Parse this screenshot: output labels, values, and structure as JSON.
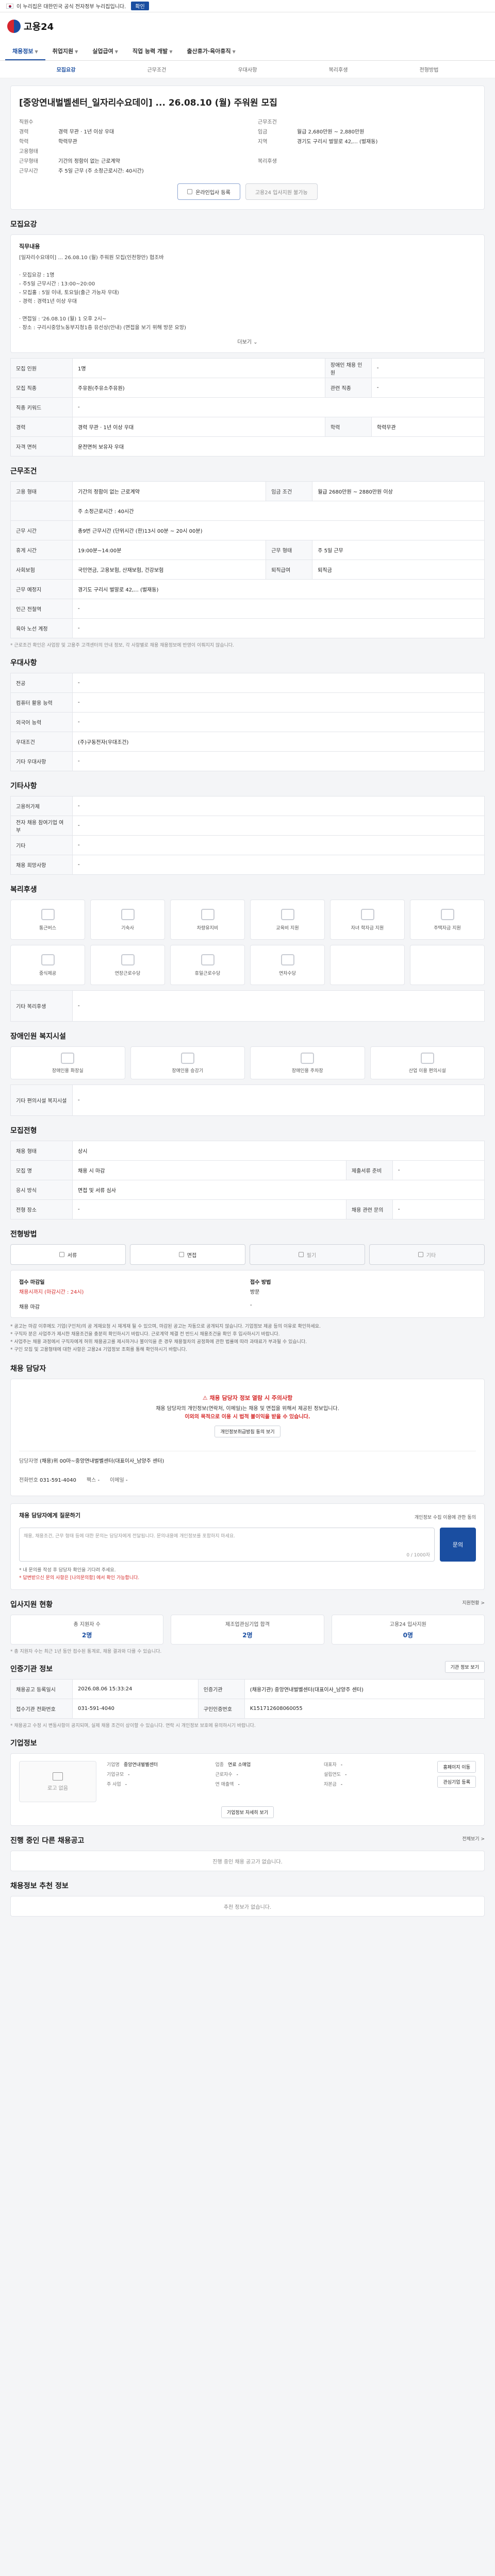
{
  "topbar": {
    "gov_notice": "이 누리집은 대한민국 공식 전자정부 누리집입니다.",
    "notice_btn": "확인"
  },
  "header": {
    "brand": "고용24"
  },
  "gnb": [
    {
      "label": "채용정보",
      "active": true
    },
    {
      "label": "취업지원",
      "active": false
    },
    {
      "label": "실업급여",
      "active": false
    },
    {
      "label": "직업 능력 개발",
      "active": false
    },
    {
      "label": "출산휴가·육아휴직",
      "active": false
    }
  ],
  "subnav": [
    {
      "label": "모집요강",
      "on": true
    },
    {
      "label": "근무조건",
      "on": false
    },
    {
      "label": "우대사항",
      "on": false
    },
    {
      "label": "복리후생",
      "on": false
    },
    {
      "label": "전형방법",
      "on": false
    }
  ],
  "job": {
    "title": "[중앙연내벌벨센터_일자리수요데이] ... 26.08.10 (월) 주워원 모집",
    "company_label": "직원을 찾는 기업",
    "left": [
      {
        "k": "직원수",
        "v": ""
      },
      {
        "k": "경력",
        "v": "경력 무관 · 1년 이상 우대"
      },
      {
        "k": "학력",
        "v": "학력무관"
      },
      {
        "k": "고용형태",
        "v": ""
      },
      {
        "k": "근무형태",
        "v": "기간의 정함이 없는 근로계약"
      },
      {
        "k": "근무시간",
        "v": "주 5일 근무 (주 소정근로시간: 40시간)"
      }
    ],
    "right": [
      {
        "k": "근무조건",
        "v": ""
      },
      {
        "k": "임금",
        "v": "월급 2,680만원 ~ 2,880만원"
      },
      {
        "k": "지역",
        "v": "경기도 구리시 벌말로 42,... (벌재동)"
      },
      {
        "k": "",
        "v": ""
      },
      {
        "k": "복리후생",
        "v": ""
      },
      {
        "k": "",
        "v": ""
      }
    ],
    "btn_apply": "온라인입사 등록",
    "btn_interest": "고용24 입사지원 불가능"
  },
  "recruit": {
    "section": "모집요강",
    "duty_title": "직무내용",
    "duty_text": "[일자리수요데이] ... 26.08.10 (월) 주워원 모집(인천항만) 협조바\n\n· 모집요강 : 1명\n  - 주5일 근무시간 : 13:00~20:00\n  - 모집홀 : 5일 이내, 토요일(출근 가능자 우대)\n  - 경력 : 경력1년 이상 우대\n\n· 면접일 : '26.08.10 (월) 1 오후 2시~\n· 장소 : 구리시중앙노동부지청1층 유선상(안내) (면접을 보기 위해 방문 요망)",
    "more": "더보기",
    "rows": [
      {
        "k1": "모집 인원",
        "v1": "1명",
        "k2": "장애인 채용 인원",
        "v2": "-"
      },
      {
        "k1": "모집 직종",
        "v1": "주유원(주유소주유원)",
        "k2": "관련 직종",
        "v2": "-"
      },
      {
        "k1": "직종 키워드",
        "v1": "-",
        "k2": "",
        "v2": ""
      },
      {
        "k1": "경력",
        "v1": "경력 무관 · 1년 이상 우대",
        "k2": "학력",
        "v2": "학력무관"
      },
      {
        "k1": "자격 면허",
        "v1": "운전면허 보유자 우대",
        "k2": "",
        "v2": ""
      }
    ],
    "license_tag": "우대"
  },
  "conditions": {
    "section": "근무조건",
    "rows": [
      {
        "k1": "고용 형태",
        "v1": "기간의 정함이 없는 근로계약",
        "k2": "임금 조건",
        "v2": "월급 2680만원 ~ 2880만원 이상"
      },
      {
        "k1": "",
        "v1": "주 소정근로시간 : 40시간",
        "k2": "",
        "v2": ""
      },
      {
        "k1": "근무 시간",
        "v1": "총9번 근무시간\n(단위시간 (한)13시 00분 ~ 20시 00분)",
        "k2": "",
        "v2": ""
      },
      {
        "k1": "휴게 시간",
        "v1": "19:00분~14:00분",
        "k2": "근무 형태",
        "v2": "주 5일 근무"
      },
      {
        "k1": "사회보험",
        "v1": "국민연금, 고용보험, 산재보험, 건강보험",
        "k2": "퇴직급여",
        "v2": "퇴직금"
      },
      {
        "k1": "근무 예정지",
        "v1": "경기도 구리시 벌말로 42,... (벌재동)",
        "k2": "",
        "v2": ""
      },
      {
        "k1": "인근 전철역",
        "v1": "-",
        "k2": "",
        "v2": ""
      },
      {
        "k1": "육아 노선 계정",
        "v1": "-",
        "k2": "",
        "v2": ""
      }
    ],
    "time_tag": "근무시간 협의",
    "map_btn": "지도 보기",
    "note": "* 근로조건 확인은 사업장 및 고용주 고객센터의 안내 정보, 각 사항별로 채용 채용정보에 반영이 이뤄지지 않습니다."
  },
  "preferred": {
    "section": "우대사항",
    "rows": [
      {
        "k": "전공",
        "v": "-"
      },
      {
        "k": "컴퓨터 활용 능력",
        "v": "-"
      },
      {
        "k": "외국어 능력",
        "v": "-"
      },
      {
        "k": "우대조건",
        "v": "(주)구동전자(우대조건)"
      },
      {
        "k": "기타 우대사항",
        "v": "-"
      }
    ]
  },
  "other": {
    "section": "기타사항",
    "rows": [
      {
        "k": "고용허가제",
        "v": "-"
      },
      {
        "k": "전자 채용 참여기업 여부",
        "v": "-"
      },
      {
        "k": "기타",
        "v": "-"
      },
      {
        "k": "채용 희망사항",
        "v": "-"
      }
    ]
  },
  "welfare": {
    "section": "복리후생",
    "items": [
      "통근버스",
      "기숙사",
      "차량유지비",
      "교육비 지원",
      "자녀 학자금 지원",
      "주택자금 지원",
      "중식제공",
      "연장근로수당",
      "휴일근로수당",
      "연차수당",
      "",
      ""
    ],
    "etc_label": "기타 복리후생",
    "etc_value": "-"
  },
  "disability": {
    "section": "장애인원 복지시설",
    "items": [
      "장애인용 화장실",
      "장애인용 승강기",
      "장애인용 주차장",
      "산업 이용 편의시설"
    ],
    "etc_label": "기타 편의시설 복지시설",
    "etc_value": "-"
  },
  "recruit_process": {
    "section": "모집전형",
    "rows": [
      {
        "k1": "채용 형태",
        "v1": "상시",
        "k2": "",
        "v2": ""
      },
      {
        "k1": "모집 명",
        "v1": "채용 시 마감",
        "k2": "제출서류 준비",
        "v2": "-"
      },
      {
        "k1": "응시 방식",
        "v1": "면접 및 서류 심사",
        "k2": "",
        "v2": ""
      },
      {
        "k1": "전형 장소",
        "v1": "-",
        "k2": "채용 관련 문의",
        "v2": "-"
      }
    ],
    "method_section": "전형방법",
    "methods": [
      {
        "label": "서류",
        "dim": false
      },
      {
        "label": "면접",
        "dim": false
      },
      {
        "label": "필기",
        "dim": true
      },
      {
        "label": "기타",
        "dim": true
      }
    ],
    "apply_box": [
      {
        "k": "접수 마감일",
        "v": "채용시까지 (마감시간 : 24시)"
      },
      {
        "k": "접수 방법",
        "v": "방문"
      },
      {
        "k": "",
        "v": "채용 마감"
      },
      {
        "k": "",
        "v": "-"
      }
    ],
    "notes": [
      "* 공고는 마감 이후에도 기업(구인처)의 공 게재요청 시 재게재 될 수 있으며, 마감된 공고는 자동으로 공개되지 않습니다. 기업정보 제공 등의 이유로 확인하세요.",
      "* 구직자 분은 사업주가 제시한 채용조건을 충분히 확인하시기 바랍니다. 근로계약 체결 전 반드시 채용조건을 확인 후 입사하시기 바랍니다.",
      "* 사업주는 채용 과정에서 구직자에게 허위 채용공고를 제시하거나 불이익을 준 경우 채용절차의 공정화에 관한 법률에 따라 과태료가 부과될 수 있습니다.",
      "* 구인 모집 및 고용형태에 대한 사항은 고용24 기업정보 조회를 통해 확인하시기 바랍니다."
    ]
  },
  "contact": {
    "section": "채용 담당자",
    "warn1": "채용 담당자 정보 열람 시 주의사항",
    "warn2a": "채용 담당자의 개인정보(연락처, 이메일)는 채용 및 면접을 위해서 제공된 정보입니다.",
    "warn2b": "이외의 목적으로 이용 시 법적 불이익을 받을 수 있습니다.",
    "view_btn": "개인정보취급방침 동의 보기",
    "name_label": "담당자명",
    "name": "(채용)위 00마~중앙연내벌벨센터(대표이사_남양주 센터)",
    "phone_label": "전화번호",
    "phone": "031-591-4040",
    "fax_label": "팩스",
    "fax": "-",
    "email_label": "이메일",
    "email": "-"
  },
  "inquiry": {
    "title": "채용 담당자에게 질문하기",
    "privacy": "개인정보 수집 이용에 관한 동의",
    "placeholder": "채용, 채용조건, 근무 형태 등에 대한 문의는 담당자에게 전달됩니다. 문의내용에 개인정보를 포함하지 마세요.",
    "counter": "0 / 1000자",
    "send": "문의",
    "note1": "* 내 문의를 작성 후 담당자 확인을 기다려 주세요.",
    "note2": "* 답변받으신 문의 사항은 [나의문의함] 에서 확인 가능합니다."
  },
  "status": {
    "section": "입사지원 현황",
    "link": "지원현황 >",
    "items": [
      {
        "label": "총 지원자 수",
        "value": "2명"
      },
      {
        "label": "제조업관심기업 합격",
        "value": "2명"
      },
      {
        "label": "고용24 입사지원",
        "value": "0명"
      }
    ],
    "note": "* 총 지원자 수는 최근 1년 동안 접수된 통계로, 채용 결과와 다를 수 있습니다."
  },
  "agency": {
    "section": "인증기관 정보",
    "btn": "기관 정보 보기",
    "rows": [
      {
        "k1": "채용공고 등록일시",
        "v1": "2026.08.06 15:33:24",
        "k2": "인증기관",
        "v2": "(채용기관) 중앙연내벌벨센터(대표이사_남양주 센터)"
      },
      {
        "k1": "접수기관 전화번호",
        "v1": "031-591-4040",
        "k2": "구인인증번호",
        "v2": "K151712608060055"
      }
    ],
    "note": "* 채용공고 수정 시 변동사항이 공지되며, 실제 채용 조건이 상이할 수 있습니다. 연락 시 개인정보 보호에 유의하시기 바랍니다."
  },
  "company": {
    "section": "기업정보",
    "logo_text": "로고 없음",
    "homepage_btn": "홈페이지 이동",
    "favorite_btn": "관심기업 등록",
    "fields": [
      {
        "k": "기업명",
        "v": "중앙연내벌벨센터"
      },
      {
        "k": "업종",
        "v": "연료 소매업"
      },
      {
        "k": "대표자",
        "v": "-"
      },
      {
        "k": "기업규모",
        "v": "-"
      },
      {
        "k": "근로자수",
        "v": "-"
      },
      {
        "k": "설립연도",
        "v": "-"
      },
      {
        "k": "주 사업",
        "v": "-"
      },
      {
        "k": "연 매출액",
        "v": "-"
      },
      {
        "k": "자본금",
        "v": "-"
      }
    ],
    "info_btn": "기업정보 자세히 보기"
  },
  "others": {
    "section": "진행 중인 다른 채용공고",
    "empty": "진행 중인 채용 공고가 없습니다.",
    "link": "전체보기 >"
  },
  "jobinfo": {
    "section": "채용정보 추천 정보",
    "empty": "추천 정보가 없습니다."
  }
}
